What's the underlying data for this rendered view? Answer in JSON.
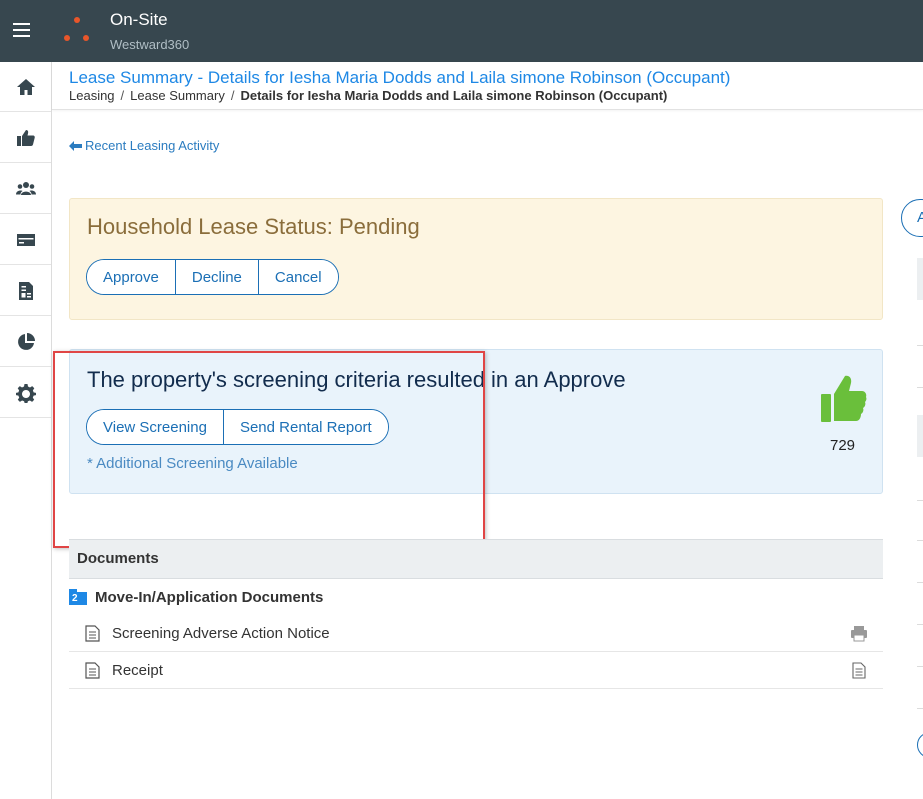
{
  "app": {
    "name": "On-Site",
    "subtitle": "Westward360",
    "brand_color": "#e8562a",
    "topbar_color": "#37474f"
  },
  "sidebar": {
    "items": [
      {
        "name": "home",
        "icon": "home-icon"
      },
      {
        "name": "leasing",
        "icon": "thumbs-up-icon"
      },
      {
        "name": "residents",
        "icon": "people-icon"
      },
      {
        "name": "payments",
        "icon": "credit-card-icon"
      },
      {
        "name": "accounting",
        "icon": "invoice-icon"
      },
      {
        "name": "reports",
        "icon": "pie-chart-icon"
      },
      {
        "name": "settings",
        "icon": "gear-icon"
      }
    ]
  },
  "header": {
    "title": "Lease Summary - Details for Iesha Maria Dodds and Laila simone Robinson (Occupant)",
    "breadcrumb": [
      "Leasing",
      "Lease Summary",
      "Details for Iesha Maria Dodds and Laila simone Robinson (Occupant)"
    ]
  },
  "back_link": {
    "label": "Recent Leasing Activity",
    "icon": "arrow-left-icon"
  },
  "lease_status": {
    "title": "Household Lease Status: Pending",
    "buttons": [
      "Approve",
      "Decline",
      "Cancel"
    ]
  },
  "screening": {
    "title": "The property's screening criteria resulted in an Approve",
    "buttons": [
      "View Screening",
      "Send Rental Report"
    ],
    "additional": "* Additional Screening Available",
    "score": "729",
    "result_icon": "thumbs-up-icon",
    "result_color": "#6abf3b"
  },
  "documents": {
    "header": "Documents",
    "folder": {
      "label": "Move-In/Application Documents",
      "count": "2"
    },
    "items": [
      {
        "name": "Screening Adverse Action Notice",
        "action_icon": "print-icon"
      },
      {
        "name": "Receipt",
        "action_icon": "document-icon"
      }
    ]
  },
  "right_panel": {
    "button_initial": "A"
  }
}
